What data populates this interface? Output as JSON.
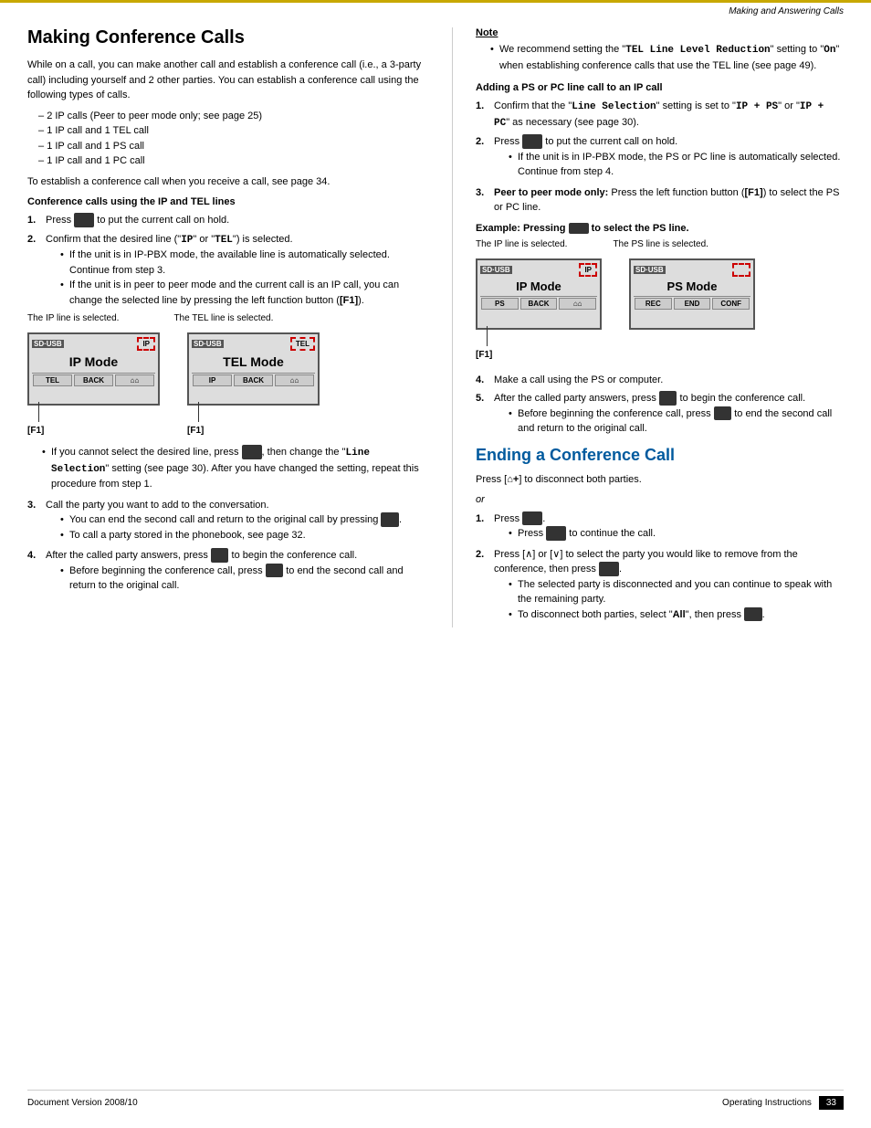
{
  "header": {
    "title": "Making and Answering Calls"
  },
  "left": {
    "page_title": "Making Conference Calls",
    "intro": "While on a call, you can make another call and establish a conference call (i.e., a 3-party call) including yourself and 2 other parties. You can establish a conference call using the following types of calls.",
    "bullet_items": [
      "2 IP calls (Peer to peer mode only; see page 25)",
      "1 IP call and 1 TEL call",
      "1 IP call and 1 PS call",
      "1 IP call and 1 PC call"
    ],
    "establish_note": "To establish a conference call when you receive a call, see page 34.",
    "conf_ip_tel_heading": "Conference calls using the IP and TEL lines",
    "steps_1": [
      {
        "num": "1",
        "text": "Press",
        "has_button": true,
        "button_text": "     ",
        "after": "to put the current call on hold."
      },
      {
        "num": "2",
        "text": "Confirm that the desired line (\"",
        "code1": "IP",
        "mid": "\" or \"",
        "code2": "TEL",
        "after": "\") is selected.",
        "sub_bullets": [
          "If the unit is in IP-PBX mode, the available line is automatically selected. Continue from step 3.",
          "If the unit is in peer to peer mode and the current call is an IP call, you can change the selected line by pressing the left function button ([F1])."
        ]
      }
    ],
    "screen_caption_left": "The IP line is selected.",
    "screen_caption_right": "The TEL line is selected.",
    "screen_left": {
      "sdusb": "SD·USB",
      "mode_indicator": "IP",
      "main_text": "IP Mode",
      "buttons": [
        "TEL",
        "BACK",
        "⌂⌂"
      ]
    },
    "screen_right": {
      "sdusb": "SD·USB",
      "mode_indicator": "TEL",
      "main_text": "TEL Mode",
      "buttons": [
        "IP",
        "BACK",
        "⌂⌂"
      ]
    },
    "f1_label": "[F1]",
    "f1_label2": "[F1]",
    "bullet_after_screen": "If you cannot select the desired line, press",
    "btn_placeholder": "     ",
    "bullet_after_screen2": ", then change the \"",
    "line_selection_code": "Line Selection",
    "bullet_after_screen3": "\" setting (see page 30). After you have changed the setting, repeat this procedure from step 1.",
    "step3": {
      "num": "3",
      "text": "Call the party you want to add to the conversation.",
      "sub_bullets": [
        "You can end the second call and return to the original call by pressing",
        "To call a party stored in the phonebook, see page 32."
      ]
    },
    "step4": {
      "num": "4",
      "text": "After the called party answers, press",
      "after": "to begin the conference call.",
      "sub_bullets": [
        "Before beginning the conference call, press",
        "to end the second call and return to the original call."
      ]
    }
  },
  "right": {
    "note_heading": "Note",
    "note_bullet": "We recommend setting the \"TEL Line Level Reduction\" setting to \"On\" when establishing conference calls that use the TEL line (see page 49).",
    "adding_heading": "Adding a PS or PC line call to an IP call",
    "adding_steps": [
      {
        "num": "1",
        "text": "Confirm that the \"Line Selection\" setting is set to \"IP + PS\" or \"IP + PC\" as necessary (see page 30)."
      },
      {
        "num": "2",
        "text": "Press",
        "has_button": true,
        "button_text": "    ",
        "after": "to put the current call on hold.",
        "sub_bullets": [
          "If the unit is in IP-PBX mode, the PS or PC line is automatically selected. Continue from step 4."
        ]
      },
      {
        "num": "3",
        "text": "Peer to peer mode only: Press the left function button ([F1]) to select the PS or PC line."
      }
    ],
    "example_heading": "Example: Pressing",
    "example_btn": "    ",
    "example_after": "to select the PS line.",
    "screen_caption_left_r": "The IP line is selected.",
    "screen_caption_right_r": "The PS line is selected.",
    "screen_left_r": {
      "sdusb": "SD·USB",
      "mode_indicator": "IP",
      "main_text": "IP Mode",
      "buttons": [
        "PS",
        "BACK",
        "⌂⌂"
      ]
    },
    "screen_right_r": {
      "sdusb": "SD·USB",
      "mode_indicator": "",
      "main_text": "PS Mode",
      "buttons": [
        "REC",
        "END",
        "CONF"
      ]
    },
    "f1_label_r": "[F1]",
    "adding_steps_cont": [
      {
        "num": "4",
        "text": "Make a call using the PS or computer."
      },
      {
        "num": "5",
        "text": "After the called party answers, press",
        "has_button": true,
        "button_text": "    ",
        "after": "to begin the conference call.",
        "sub_bullets": [
          "Before beginning the conference call, press",
          "to end the second call and return to the original call."
        ]
      }
    ],
    "ending_title": "Ending a Conference Call",
    "ending_p1": "Press [",
    "ending_icon": "⌂+",
    "ending_p1_after": "] to disconnect both parties.",
    "ending_or": "or",
    "ending_steps": [
      {
        "num": "1",
        "text": "Press",
        "has_button": true,
        "button_text": "    ",
        "after": ".",
        "sub_bullets": [
          "Press",
          "to continue the call."
        ]
      },
      {
        "num": "2",
        "text": "Press [∧] or [∨] to select the party you would like to remove from the conference, then press",
        "has_button_end": true,
        "button_text_end": "    ",
        "after": ".",
        "sub_bullets": [
          "The selected party is disconnected and you can continue to speak with the remaining party.",
          "To disconnect both parties, select \"All\", then press"
        ]
      }
    ]
  },
  "footer": {
    "doc_version": "Document Version    2008/10",
    "right_text": "Operating Instructions",
    "page_number": "33"
  }
}
